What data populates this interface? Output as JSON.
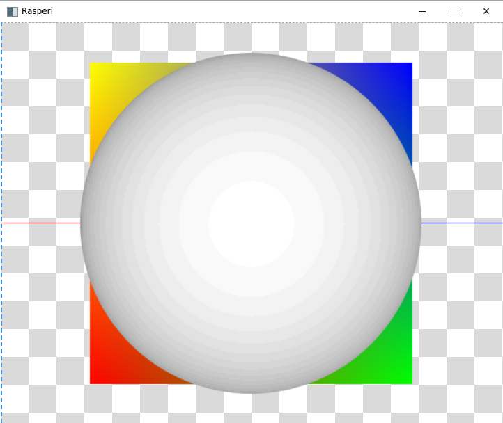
{
  "window": {
    "title": "Rasperi",
    "icon": "app-icon",
    "buttons": [
      "minimize",
      "maximize",
      "close"
    ]
  },
  "controls": {
    "minimize_glyph": "—",
    "maximize_glyph": "☐",
    "close_glyph": "✕"
  },
  "scene": {
    "gradient_corners": {
      "top_left": "#ffff00",
      "top_right": "#0000ff",
      "bottom_left": "#ff0000",
      "bottom_right": "#00ff00"
    },
    "left_line_color": "#ff0000",
    "right_line_color": "#0000ff",
    "sphere_color": "#ffffff",
    "checker_colors": [
      "#ffffff",
      "#dadada"
    ]
  }
}
